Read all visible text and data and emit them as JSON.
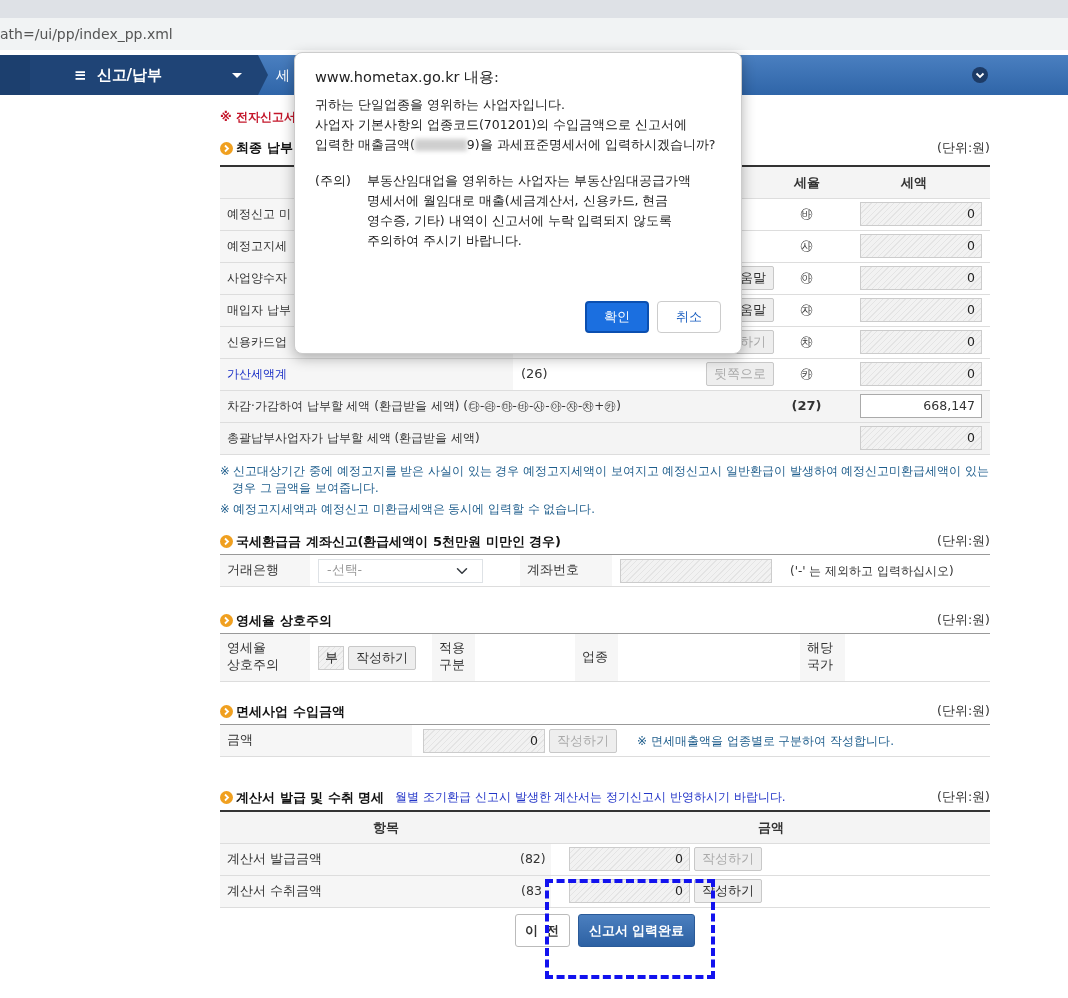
{
  "browser": {
    "address": "ath=/ui/pp/index_pp.xml"
  },
  "nav": {
    "menu_icon": "≡",
    "menu": "신고/납부",
    "crumb": "세"
  },
  "warning": "※ 전자신고서",
  "final_tax": {
    "title": "최종 납부",
    "unit": "(단위:원)",
    "columns": [
      "세율",
      "세액"
    ],
    "rows": [
      {
        "kind": "plain",
        "label": "예정신고 미",
        "marker": "㉳",
        "amount": "0",
        "amount_disabled": true
      },
      {
        "kind": "plain",
        "label": "예정고지세",
        "marker": "㉴",
        "amount": "0",
        "amount_disabled": true
      },
      {
        "kind": "plain",
        "label": "사업양수자",
        "button": "움말",
        "button_disabled": false,
        "marker": "㉵",
        "amount": "0",
        "amount_disabled": true
      },
      {
        "kind": "plain",
        "label": "매입자 납부",
        "button": "움말",
        "button_disabled": false,
        "marker": "㉶",
        "amount": "0",
        "amount_disabled": true
      },
      {
        "kind": "plain",
        "label": "신용카드업",
        "button": "하기",
        "button_disabled": true,
        "marker": "㉷",
        "amount": "0",
        "amount_disabled": true
      },
      {
        "kind": "link",
        "label": "가산세액계",
        "code": "(26)",
        "button": "뒷쪽으로",
        "button_disabled": true,
        "marker": "㉸",
        "amount": "0",
        "amount_disabled": true
      },
      {
        "kind": "total",
        "label": "차감·가감하여 납부할 세액 (환급받을 세액) (㉰-㉱-㉲-㉳-㉴-㉵-㉶-㉷+㉸)",
        "code": "(27)",
        "amount": "668,147",
        "amount_disabled": false
      },
      {
        "kind": "total",
        "label": "총괄납부사업자가 납부할 세액 (환급받을 세액)",
        "amount": "0",
        "amount_disabled": true
      }
    ]
  },
  "notes": [
    "※ 신고대상기간 중에 예정고지를 받은 사실이 있는 경우 예정고지세액이 보여지고 예정신고시 일반환급이 발생하여 예정신고미환급세액이 있는 경우 그 금액을 보여줍니다.",
    "※ 예정고지세액과 예정신고 미환급세액은 동시에 입력할 수 없습니다."
  ],
  "refund_account": {
    "title": "국세환급금 계좌신고(환급세액이 5천만원 미만인 경우)",
    "unit": "(단위:원)",
    "bank_label": "거래은행",
    "bank_placeholder": "-선택-",
    "account_label": "계좌번호",
    "account_hint": "('-' 는 제외하고 입력하십시오)"
  },
  "zero_rate": {
    "title": "영세율 상호주의",
    "unit": "(단위:원)",
    "label": "영세율 상호주의",
    "value": "부",
    "button": "작성하기",
    "apply_label": "적용 구분",
    "industry_label": "업종",
    "country_label": "해당 국가"
  },
  "exempt": {
    "title": "면세사업 수입금액",
    "unit": "(단위:원)",
    "label": "금액",
    "amount": "0",
    "button": "작성하기",
    "button_disabled": true,
    "note": "※ 면세매출액을 업종별로 구분하여 작성합니다."
  },
  "invoices": {
    "title": "계산서 발급 및 수취 명세",
    "note": "월별 조기환급 신고시 발생한 계산서는 정기신고시 반영하시기 바랍니다.",
    "unit": "(단위:원)",
    "columns": [
      "항목",
      "금액"
    ],
    "rows": [
      {
        "label": "계산서 발급금액",
        "code": "(82)",
        "amount": "0",
        "button": "작성하기",
        "button_disabled": true
      },
      {
        "label": "계산서 수취금액",
        "code": "(83",
        "amount": "0",
        "button": "작성하기",
        "button_disabled": false
      }
    ]
  },
  "actions": [
    {
      "kind": "secondary",
      "label": "이전"
    },
    {
      "kind": "primary",
      "label": "신고서 입력완료"
    }
  ],
  "dialog": {
    "title": "www.hometax.go.kr 내용:",
    "lines": [
      [
        {
          "kind": "text",
          "text": "귀하는 단일업종을 영위하는 사업자입니다."
        }
      ],
      [
        {
          "kind": "text",
          "text": "사업자 기본사항의 업종코드(701201)의 수입금액으로 신고서에"
        }
      ],
      [
        {
          "kind": "text",
          "text": "입력한 매출금액("
        },
        {
          "kind": "blur"
        },
        {
          "kind": "text",
          "text": "9)을 과세표준명세서에 입력하시겠습니까?"
        }
      ]
    ],
    "notice_label": "(주의)",
    "notice_lines": [
      "부동산임대업을 영위하는 사업자는 부동산임대공급가액",
      "명세서에 월임대로 매출(세금계산서, 신용카드, 현금",
      "영수증, 기타) 내역이 신고서에 누락 입력되지 않도록",
      "주의하여 주시기 바랍니다."
    ],
    "buttons": [
      {
        "label": "확인",
        "selected": true
      },
      {
        "label": "취소",
        "selected": false
      }
    ]
  }
}
